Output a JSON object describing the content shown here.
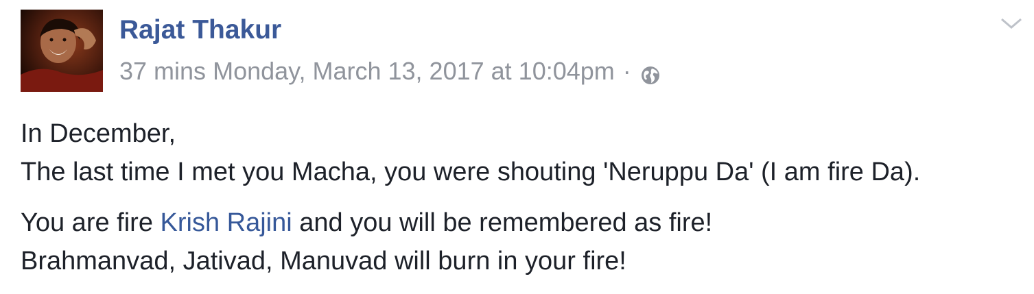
{
  "post": {
    "author_name": "Rajat Thakur",
    "time_relative": "37 mins",
    "timestamp": "Monday, March 13, 2017 at 10:04pm",
    "separator": "·",
    "privacy_icon": "globe-icon",
    "menu_icon": "chevron-down-icon",
    "avatar_icon": "profile-photo",
    "paragraph1": {
      "line1": "In December,",
      "line2": "The last time I met you Macha, you were shouting 'Neruppu Da' (I am fire Da)."
    },
    "paragraph2": {
      "line1_before": "You are fire ",
      "mention": "Krish Rajini",
      "line1_after": " and you will be remembered as fire!",
      "line2": "Brahmanvad, Jativad, Manuvad will burn in your fire!"
    }
  },
  "colors": {
    "author": "#3b5998",
    "meta": "#90949c",
    "text": "#1d2129",
    "mention": "#365899"
  }
}
